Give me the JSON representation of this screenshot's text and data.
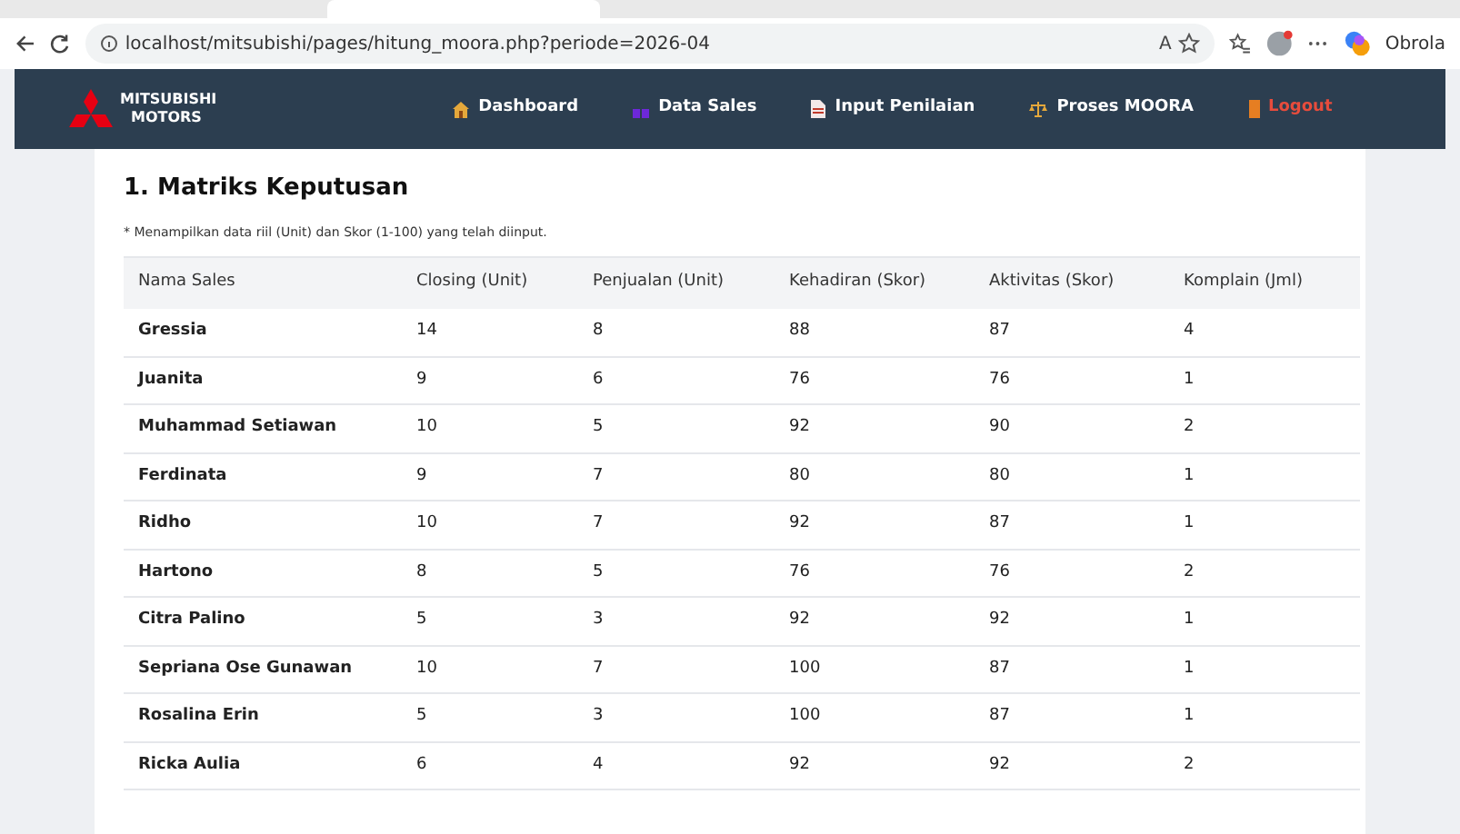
{
  "browser": {
    "url": "localhost/mitsubishi/pages/hitung_moora.php?periode=2026-04",
    "read_aloud": "A",
    "copilot_label": "Obrola"
  },
  "navbar": {
    "brand_line1": "MITSUBISHI",
    "brand_line2": "MOTORS",
    "items": [
      {
        "label": "Dashboard",
        "kind": "home"
      },
      {
        "label": "Data Sales",
        "kind": "people"
      },
      {
        "label": "Input Penilaian",
        "kind": "doc"
      },
      {
        "label": "Proses MOORA",
        "kind": "scale"
      },
      {
        "label": "Logout",
        "kind": "logout"
      }
    ]
  },
  "section": {
    "title": "1. Matriks Keputusan",
    "note": "* Menampilkan data riil (Unit) dan Skor (1-100) yang telah diinput."
  },
  "table": {
    "columns": [
      "Nama Sales",
      "Closing (Unit)",
      "Penjualan (Unit)",
      "Kehadiran (Skor)",
      "Aktivitas (Skor)",
      "Komplain (Jml)"
    ],
    "rows": [
      [
        "Gressia",
        "14",
        "8",
        "88",
        "87",
        "4"
      ],
      [
        "Juanita",
        "9",
        "6",
        "76",
        "76",
        "1"
      ],
      [
        "Muhammad Setiawan",
        "10",
        "5",
        "92",
        "90",
        "2"
      ],
      [
        "Ferdinata",
        "9",
        "7",
        "80",
        "80",
        "1"
      ],
      [
        "Ridho",
        "10",
        "7",
        "92",
        "87",
        "1"
      ],
      [
        "Hartono",
        "8",
        "5",
        "76",
        "76",
        "2"
      ],
      [
        "Citra Palino",
        "5",
        "3",
        "92",
        "92",
        "1"
      ],
      [
        "Sepriana Ose Gunawan",
        "10",
        "7",
        "100",
        "87",
        "1"
      ],
      [
        "Rosalina Erin",
        "5",
        "3",
        "100",
        "87",
        "1"
      ],
      [
        "Ricka Aulia",
        "6",
        "4",
        "92",
        "92",
        "2"
      ]
    ]
  }
}
